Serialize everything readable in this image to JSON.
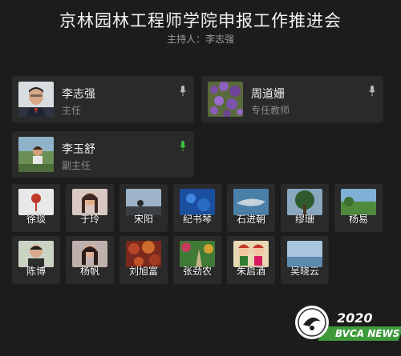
{
  "meeting": {
    "title": "京林园林工程师学院申报工作推进会",
    "host": "主持人：李志强"
  },
  "featured": [
    {
      "name": "李志强",
      "role": "主任",
      "mic": "muted",
      "photo": "portrait-man"
    },
    {
      "name": "周道姗",
      "role": "专任教师",
      "mic": "muted",
      "photo": "purple-flowers"
    },
    {
      "name": "李玉舒",
      "role": "副主任",
      "mic": "speaking",
      "photo": "outdoor-woman"
    }
  ],
  "participants": [
    {
      "name": "徐琰",
      "photo": "lantern"
    },
    {
      "name": "于玲",
      "photo": "woman-portrait"
    },
    {
      "name": "宋阳",
      "photo": "sky-silhouette"
    },
    {
      "name": "纪书琴",
      "photo": "blue-abstract"
    },
    {
      "name": "石进朝",
      "photo": "shark"
    },
    {
      "name": "缪珊",
      "photo": "tree"
    },
    {
      "name": "杨易",
      "photo": "green-landscape"
    },
    {
      "name": "陈博",
      "photo": "man-portrait"
    },
    {
      "name": "杨帆",
      "photo": "woman-portrait-2"
    },
    {
      "name": "刘旭富",
      "photo": "red-foliage"
    },
    {
      "name": "张劲农",
      "photo": "garden-path"
    },
    {
      "name": "朱启酒",
      "photo": "cartoon-figures"
    },
    {
      "name": "吴晓云",
      "photo": "sky-water"
    }
  ],
  "badge": {
    "year": "2020",
    "label": "BVCA NEWS"
  },
  "colors": {
    "background": "#1c1c1c",
    "card": "#2a2a2a",
    "speaking_mic": "#3fbf3f",
    "badge_green": "#3f9a3c"
  }
}
